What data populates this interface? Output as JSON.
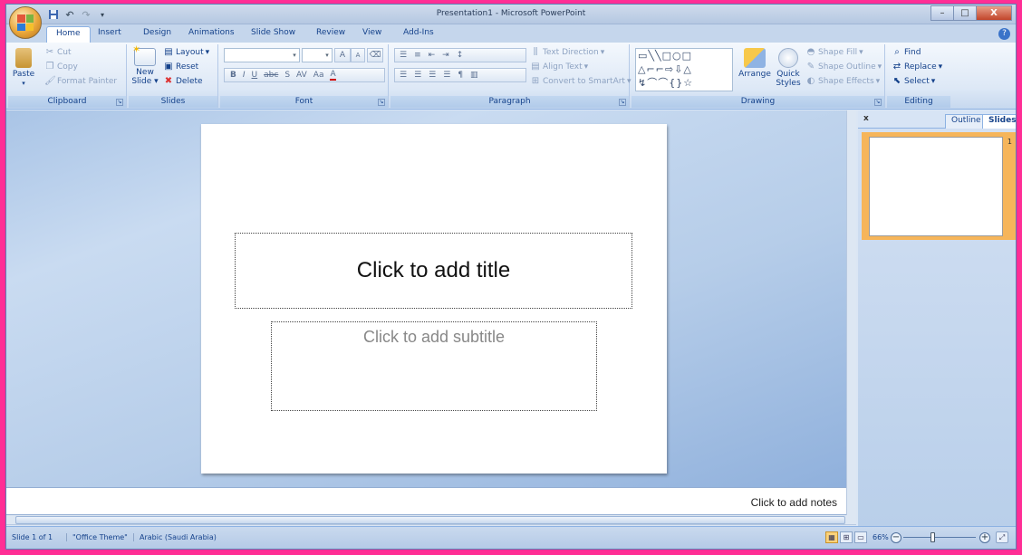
{
  "title": "Presentation1 - Microsoft PowerPoint",
  "window_controls": {
    "minimize": "–",
    "maximize": "□",
    "close": "X"
  },
  "tabs": [
    "Home",
    "Insert",
    "Design",
    "Animations",
    "Slide Show",
    "Review",
    "View",
    "Add-Ins"
  ],
  "active_tab": "Home",
  "ribbon": {
    "clipboard": {
      "label": "Clipboard",
      "paste": "Paste",
      "cut": "Cut",
      "copy": "Copy",
      "format_painter": "Format Painter"
    },
    "slides": {
      "label": "Slides",
      "new_slide": "New",
      "new_slide2": "Slide",
      "layout": "Layout",
      "reset": "Reset",
      "delete": "Delete"
    },
    "font": {
      "label": "Font",
      "bold": "B",
      "italic": "I",
      "underline": "U",
      "strike": "abc",
      "shadow": "S",
      "spacing": "AV",
      "case": "Aa",
      "color": "A",
      "grow": "A",
      "shrink": "A"
    },
    "paragraph": {
      "label": "Paragraph",
      "text_direction": "Text Direction",
      "align_text": "Align Text",
      "convert_smartart": "Convert to SmartArt"
    },
    "drawing": {
      "label": "Drawing",
      "arrange": "Arrange",
      "quick_styles": "Quick",
      "quick_styles2": "Styles",
      "shape_fill": "Shape Fill",
      "shape_outline": "Shape Outline",
      "shape_effects": "Shape Effects"
    },
    "editing": {
      "label": "Editing",
      "find": "Find",
      "replace": "Replace",
      "select": "Select"
    }
  },
  "slide": {
    "title_placeholder": "Click to add title",
    "subtitle_placeholder": "Click to add subtitle"
  },
  "pane": {
    "close": "x",
    "tab_outline": "Outline",
    "tab_slides": "Slides",
    "thumb_number": "1"
  },
  "notes": {
    "placeholder": "Click to add notes"
  },
  "status": {
    "slide": "Slide 1 of 1",
    "theme": "\"Office Theme\"",
    "language": "Arabic (Saudi Arabia)",
    "zoom": "66%"
  },
  "colors": {
    "frame": "#ff2e95",
    "ribbon_text": "#15428b",
    "thumb_highlight": "#f6b55a"
  }
}
